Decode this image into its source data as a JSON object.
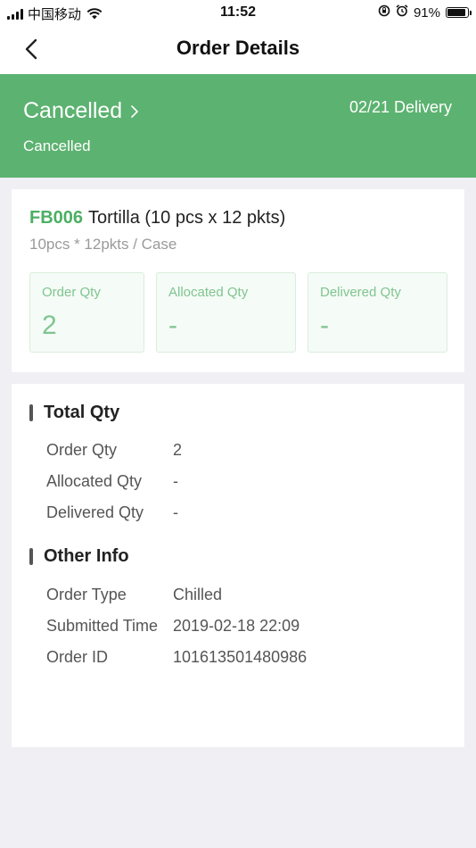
{
  "status_bar": {
    "carrier": "中国移动",
    "time": "11:52",
    "battery": "91%"
  },
  "nav": {
    "title": "Order Details"
  },
  "banner": {
    "status": "Cancelled",
    "substatus": "Cancelled",
    "delivery": "02/21 Delivery",
    "color": "#5cb270"
  },
  "product": {
    "code": "FB006",
    "name": "Tortilla (10 pcs x 12 pkts)",
    "spec": "10pcs * 12pkts / Case",
    "boxes": [
      {
        "label": "Order Qty",
        "value": "2"
      },
      {
        "label": "Allocated Qty",
        "value": "-"
      },
      {
        "label": "Delivered Qty",
        "value": "-"
      }
    ]
  },
  "total_qty": {
    "title": "Total Qty",
    "rows": [
      {
        "label": "Order Qty",
        "value": "2"
      },
      {
        "label": "Allocated Qty",
        "value": "-"
      },
      {
        "label": "Delivered Qty",
        "value": "-"
      }
    ]
  },
  "other_info": {
    "title": "Other Info",
    "rows": [
      {
        "label": "Order Type",
        "value": "Chilled"
      },
      {
        "label": "Submitted Time",
        "value": "2019-02-18 22:09"
      },
      {
        "label": "Order ID",
        "value": "101613501480986"
      }
    ]
  }
}
